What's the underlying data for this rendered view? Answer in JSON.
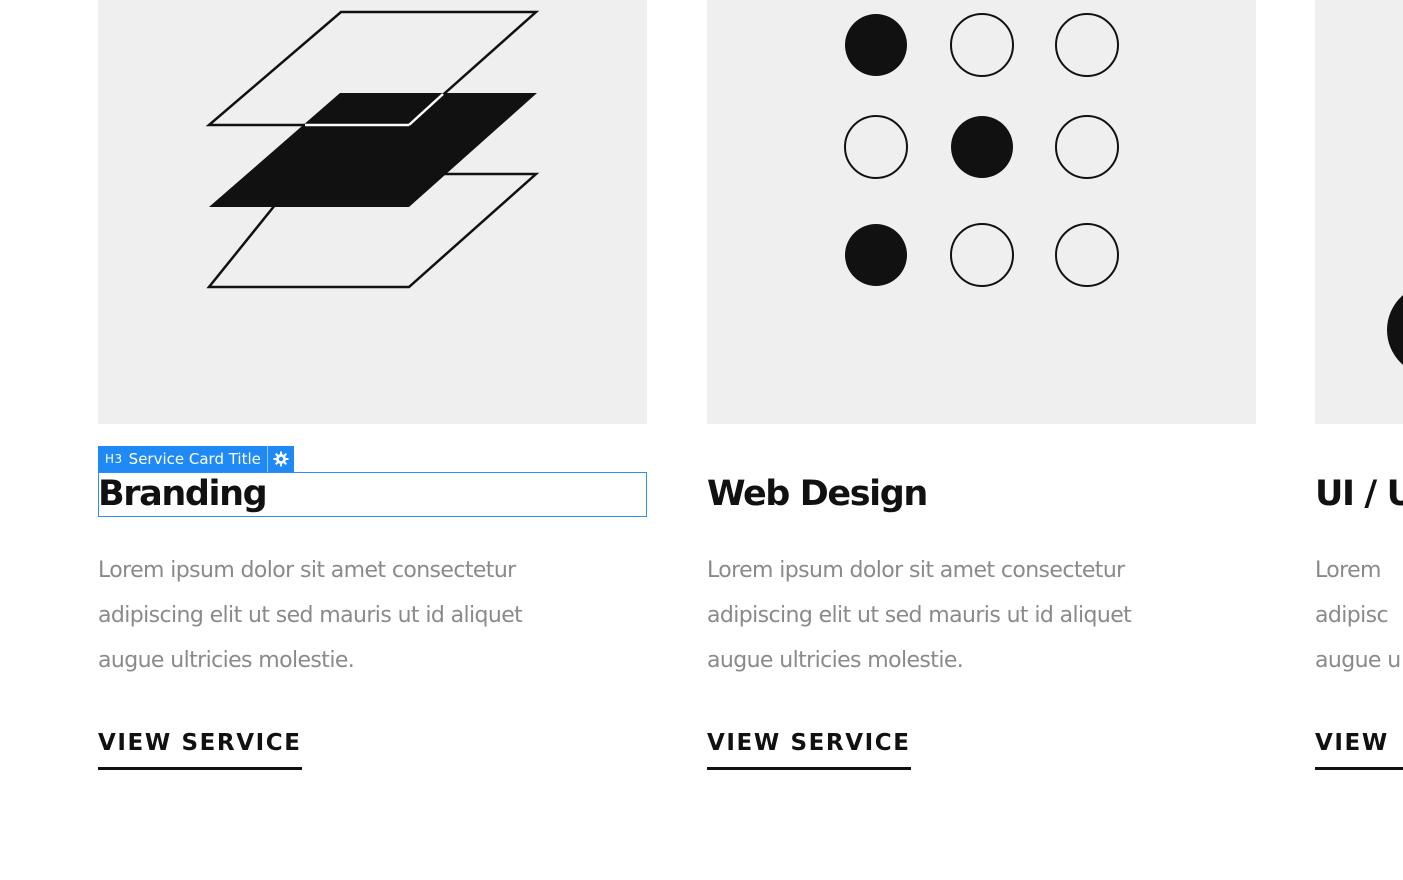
{
  "editor": {
    "tag": "H3",
    "label": "Service Card Title"
  },
  "cards": [
    {
      "title": "Branding",
      "desc_lines": [
        "Lorem ipsum dolor sit amet consectetur",
        "adipiscing elit ut sed mauris ut id aliquet",
        "augue ultricies molestie."
      ],
      "link": "VIEW SERVICE",
      "icon": "stacked-layers-icon"
    },
    {
      "title": "Web Design",
      "desc_lines": [
        "Lorem ipsum dolor sit amet consectetur",
        "adipiscing elit ut sed mauris ut id aliquet",
        "augue ultricies molestie."
      ],
      "link": "VIEW SERVICE",
      "icon": "dot-grid-icon"
    },
    {
      "title": "UI / U",
      "desc_lines": [
        "Lorem",
        "adipisc",
        "augue u"
      ],
      "link": "VIEW",
      "icon": "half-circle-icon"
    }
  ],
  "colors": {
    "card_bg": "#efefef",
    "ink": "#111111",
    "muted_text": "#8a8a8a",
    "selection_blue": "#1f8af5"
  }
}
